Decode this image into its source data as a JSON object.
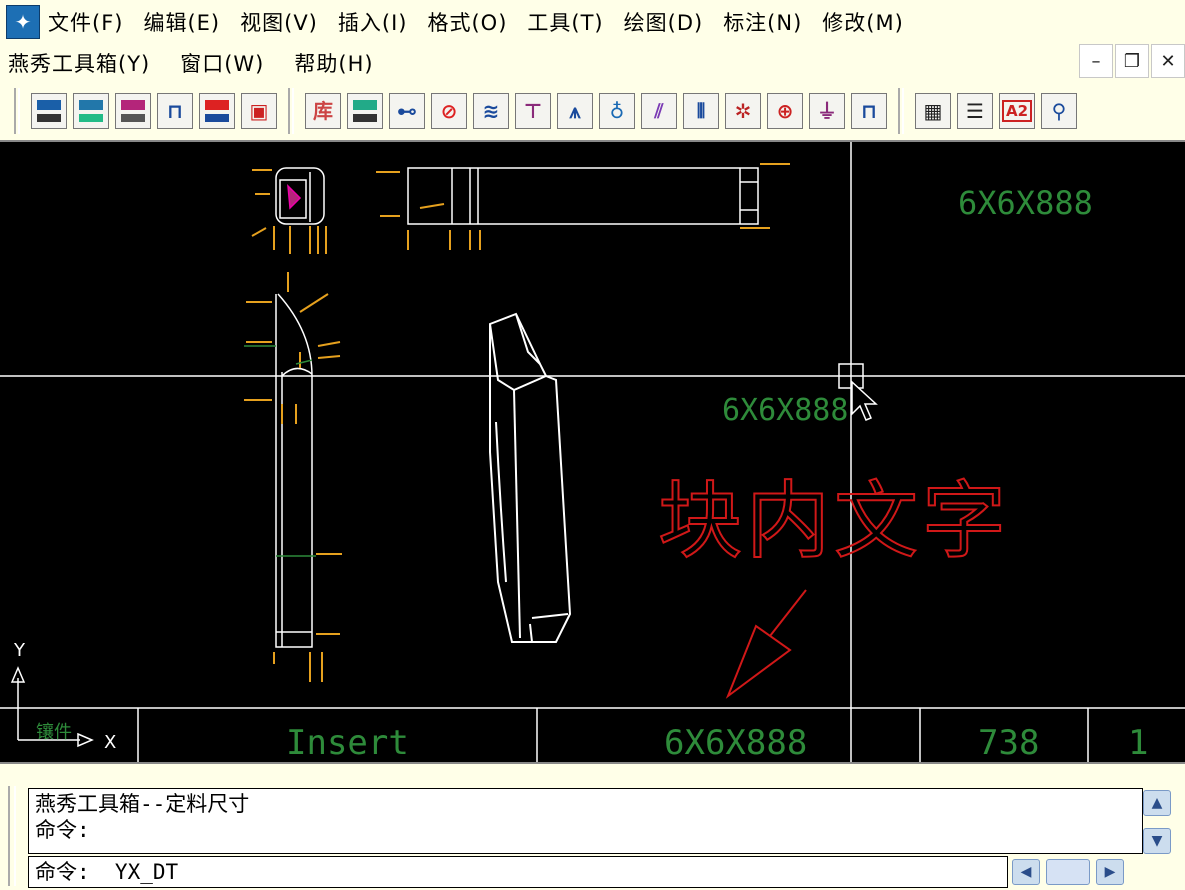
{
  "app_icon": "autocad-app-icon",
  "menus": {
    "row1": [
      "文件(F)",
      "编辑(E)",
      "视图(V)",
      "插入(I)",
      "格式(O)",
      "工具(T)",
      "绘图(D)",
      "标注(N)",
      "修改(M)"
    ],
    "row2": [
      "燕秀工具箱(Y)",
      "窗口(W)",
      "帮助(H)"
    ]
  },
  "window_controls": [
    "minimize-icon",
    "restore-icon",
    "close-icon"
  ],
  "toolbar": {
    "group1": [
      "mold-base-icon",
      "mold-plate-icon",
      "ejector-icon",
      "runner-icon",
      "plate-red-icon",
      "frame-icon"
    ],
    "group2_label": "库",
    "group2": [
      "library-icon",
      "standard-part-icon",
      "line-icon",
      "no-entry-icon",
      "spring-icon",
      "screw-icon",
      "sprue-icon",
      "pin-icon",
      "slant-icon",
      "column-icon",
      "gear-icon",
      "target-icon",
      "funnel-icon",
      "bracket-icon"
    ],
    "group3": [
      "bom-grid-icon",
      "list-icon",
      "paper-a2-icon",
      "zoom-icon"
    ],
    "paper_label": "A2"
  },
  "drawing": {
    "label_top_right": "6X6X888",
    "label_cursor": "6X6X888",
    "block_text": "块内文字",
    "ucs_y": "Y",
    "ucs_x": "X",
    "ucs_tag": "镶件",
    "title_block": [
      "Insert",
      "6X6X888",
      "738",
      "1"
    ]
  },
  "command": {
    "history": [
      "燕秀工具箱--定料尺寸",
      "命令:"
    ],
    "current": "命令:  YX_DT"
  },
  "colors": {
    "menu_bg": "#ffffe8",
    "canvas_bg": "#000000",
    "geometry": "#ffffff",
    "dimension": "#e6a11e",
    "green_text": "#2e8b3a",
    "red_text": "#d01818"
  }
}
